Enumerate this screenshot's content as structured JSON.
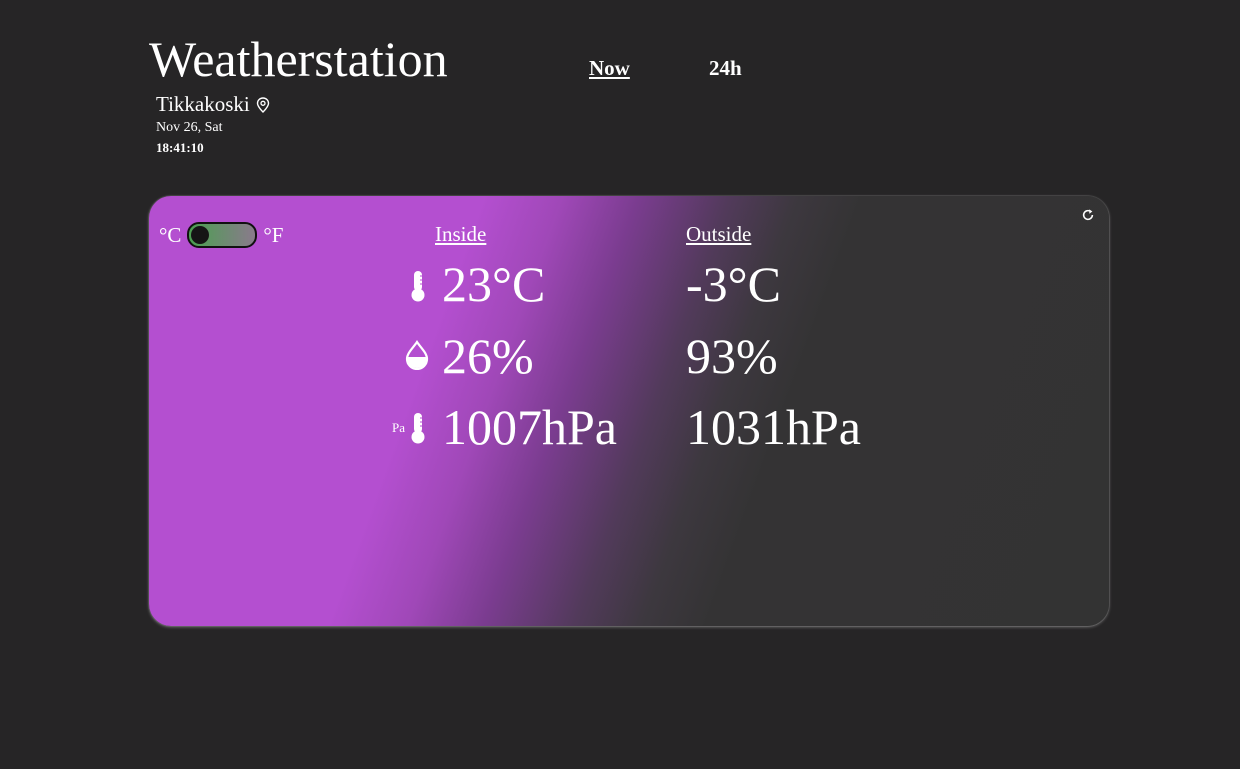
{
  "app": {
    "title": "Weatherstation"
  },
  "nav": {
    "now": "Now",
    "h24": "24h"
  },
  "location": {
    "name": "Tikkakoski",
    "date": "Nov 26, Sat",
    "time": "18:41:10"
  },
  "units": {
    "celsius": "°C",
    "fahrenheit": "°F",
    "selected": "°C"
  },
  "columns": {
    "inside": "Inside",
    "outside": "Outside"
  },
  "readings": {
    "inside": {
      "temperature": "23°C",
      "humidity": "26%",
      "pressure": "1007hPa"
    },
    "outside": {
      "temperature": "-3°C",
      "humidity": "93%",
      "pressure": "1031hPa"
    }
  },
  "pressure_icon_label": "Pa",
  "colors": {
    "accent": "#b44fd0",
    "background": "#262526",
    "card": "#333333"
  }
}
